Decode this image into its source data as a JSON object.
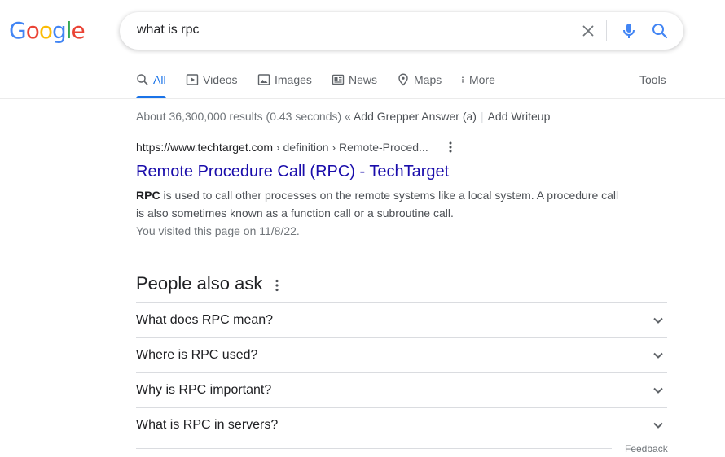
{
  "logo": {
    "letters": [
      {
        "char": "G",
        "color": "#4285f4"
      },
      {
        "char": "o",
        "color": "#ea4335"
      },
      {
        "char": "o",
        "color": "#fbbc05"
      },
      {
        "char": "g",
        "color": "#4285f4"
      },
      {
        "char": "l",
        "color": "#34a853"
      },
      {
        "char": "e",
        "color": "#ea4335"
      }
    ]
  },
  "search": {
    "query": "what is rpc",
    "clear_icon": "close-icon",
    "voice_icon": "mic-icon",
    "search_icon": "search-icon"
  },
  "tabs": [
    {
      "label": "All",
      "icon": "search-icon",
      "active": true
    },
    {
      "label": "Videos",
      "icon": "play-icon"
    },
    {
      "label": "Images",
      "icon": "image-icon"
    },
    {
      "label": "News",
      "icon": "news-icon"
    },
    {
      "label": "Maps",
      "icon": "map-pin-icon"
    },
    {
      "label": "More",
      "icon": "more-vert-icon"
    }
  ],
  "tools_label": "Tools",
  "stats": {
    "text": "About 36,300,000 results (0.43 seconds) «",
    "grepper": "Add Grepper Answer (a)",
    "separator": "|",
    "writeup": "Add Writeup"
  },
  "result": {
    "url": "https://www.techtarget.com",
    "path": " › definition › Remote-Proced...",
    "title": "Remote Procedure Call (RPC) - TechTarget",
    "snippet_bold": "RPC",
    "snippet_rest": " is used to call other processes on the remote systems like a local system. A procedure call is also sometimes known as a function call or a subroutine call.",
    "visited": "You visited this page on 11/8/22."
  },
  "paa": {
    "title": "People also ask",
    "questions": [
      "What does RPC mean?",
      "Where is RPC used?",
      "Why is RPC important?",
      "What is RPC in servers?"
    ]
  },
  "feedback": "Feedback",
  "colors": {
    "link": "#1a0dab",
    "accent": "#1a73e8",
    "muted": "#70757a"
  }
}
